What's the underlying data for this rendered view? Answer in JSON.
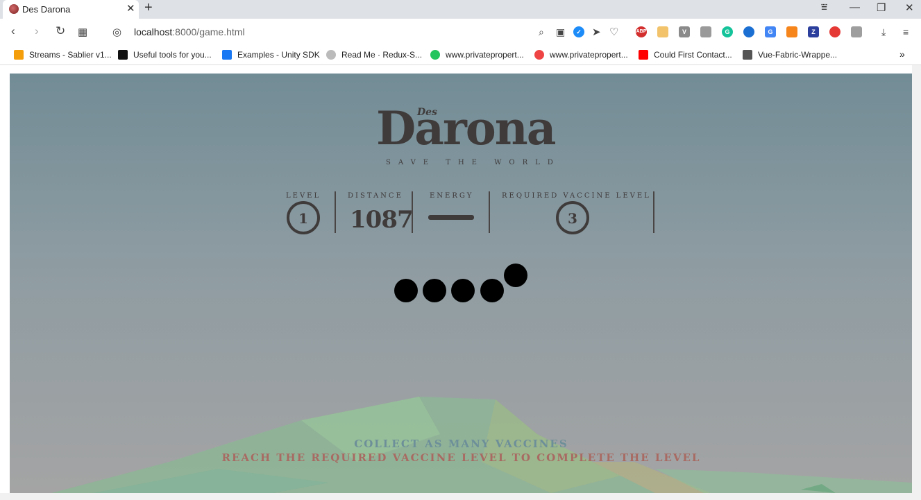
{
  "browser": {
    "tab_title": "Des Darona",
    "tab_close": "✕",
    "new_tab": "+",
    "url_host": "localhost",
    "url_rest": ":8000/game.html",
    "window_controls": [
      "⩸",
      "—",
      "❐",
      "✕"
    ]
  },
  "bookmarks": [
    {
      "label": "Streams - Sablier v1...",
      "icon": "sablier-icon",
      "color": "#f59e0b"
    },
    {
      "label": "Useful tools for you...",
      "icon": "medium-icon",
      "color": "#111111"
    },
    {
      "label": "Examples - Unity SDK",
      "icon": "facebook-icon",
      "color": "#1877f2"
    },
    {
      "label": "Read Me · Redux-S...",
      "icon": "redux-icon",
      "color": "#aaaaaa"
    },
    {
      "label": "www.privatepropert...",
      "icon": "privateproperty-icon",
      "color": "#22c55e"
    },
    {
      "label": "www.privatepropert...",
      "icon": "privateproperty-alt-icon",
      "color": "#ef4444"
    },
    {
      "label": "Could First Contact...",
      "icon": "youtube-icon",
      "color": "#ff0000"
    },
    {
      "label": "Vue-Fabric-Wrappe...",
      "icon": "file-icon",
      "color": "#555555"
    }
  ],
  "bookmarks_more": "»",
  "game": {
    "logo_des": "Des",
    "logo_main": "Darona",
    "logo_sub": "SAVE THE WORLD",
    "stats": {
      "level_label": "LEVEL",
      "level_value": "1",
      "distance_label": "DISTANCE",
      "distance_value": "1087",
      "energy_label": "ENERGY",
      "required_label": "REQUIRED VACCINE LEVEL",
      "required_value": "3"
    },
    "message_1": "COLLECT AS MANY VACCINES",
    "message_2": "REACH THE REQUIRED VACCINE LEVEL TO COMPLETE THE LEVEL"
  },
  "colors": {
    "logo": "#3f3b3b",
    "message_1": "#6d8f99",
    "message_2": "#a86a62",
    "sky_top": "#728c96",
    "sky_bottom": "#a4a4a4"
  }
}
